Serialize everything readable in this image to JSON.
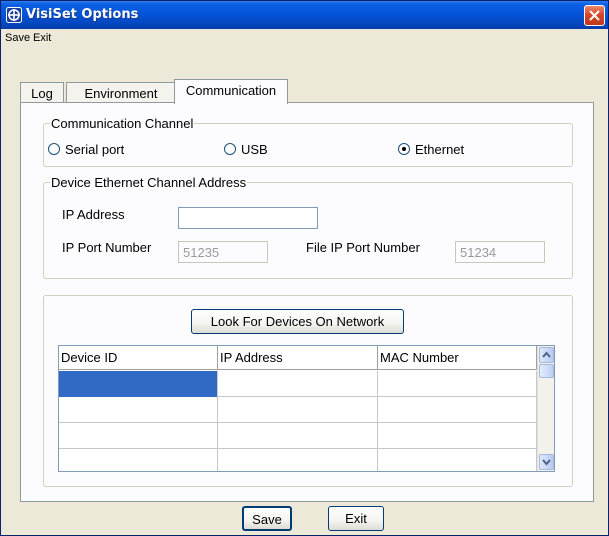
{
  "window": {
    "title": "VisiSet Options"
  },
  "menu": {
    "items": [
      "Save",
      "Exit"
    ]
  },
  "tabs": [
    "Log",
    "Environment",
    "Communication"
  ],
  "active_tab": "Communication",
  "communication_channel": {
    "label": "Communication Channel",
    "options": [
      {
        "label": "Serial port",
        "checked": false
      },
      {
        "label": "USB",
        "checked": false
      },
      {
        "label": "Ethernet",
        "checked": true
      }
    ]
  },
  "ethernet": {
    "label": "Device Ethernet Channel Address",
    "ip_address_label": "IP Address",
    "ip_address_value": "",
    "ip_port_label": "IP Port Number",
    "ip_port_value": "51235",
    "file_port_label": "File IP Port Number",
    "file_port_value": "51234"
  },
  "devices": {
    "look_button": "Look For Devices On Network",
    "columns": [
      "Device ID",
      "IP Address",
      "MAC Number"
    ],
    "row_count": 4
  },
  "footer": {
    "save": "Save",
    "exit": "Exit"
  },
  "colors": {
    "titlebar": "#0553d6",
    "selection": "#316ac5",
    "panel": "#fcfcfe",
    "dialog": "#ece9d8"
  }
}
